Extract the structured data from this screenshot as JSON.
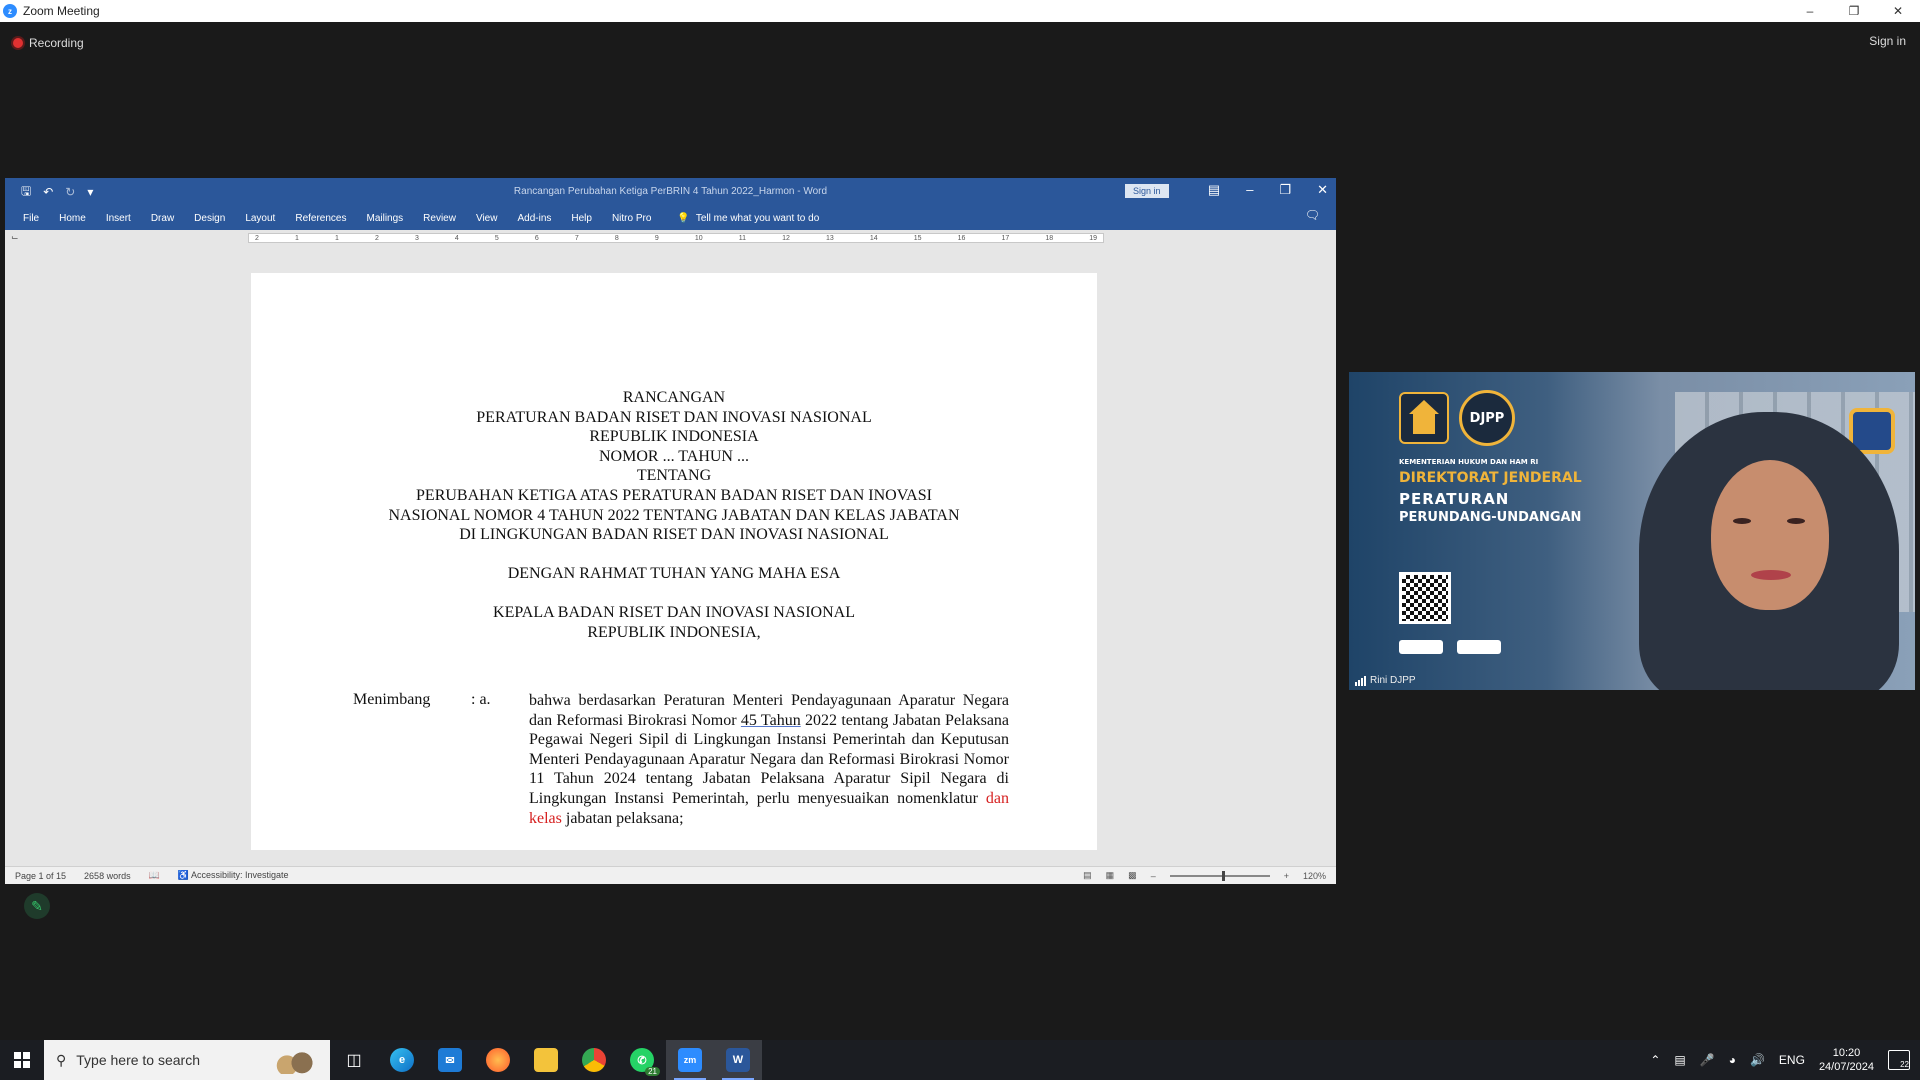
{
  "zoom": {
    "window_title": "Zoom Meeting",
    "recording_label": "Recording",
    "sign_in": "Sign in",
    "controls": {
      "minimize": "–",
      "maximize": "❐",
      "close": "✕"
    }
  },
  "word": {
    "doc_title": "Rancangan Perubahan Ketiga PerBRIN 4 Tahun 2022_Harmon  -  Word",
    "sign_in": "Sign in",
    "ribbon_tabs": [
      "File",
      "Home",
      "Insert",
      "Draw",
      "Design",
      "Layout",
      "References",
      "Mailings",
      "Review",
      "View",
      "Add-ins",
      "Help",
      "Nitro Pro"
    ],
    "tell_me": "Tell me what you want to do",
    "ruler_marks": [
      "2",
      "1",
      "1",
      "2",
      "3",
      "4",
      "5",
      "6",
      "7",
      "8",
      "9",
      "10",
      "11",
      "12",
      "13",
      "14",
      "15",
      "16",
      "17",
      "18",
      "19"
    ],
    "document": {
      "heading_lines": [
        "RANCANGAN",
        "PERATURAN BADAN RISET DAN INOVASI NASIONAL",
        "REPUBLIK INDONESIA",
        "NOMOR ... TAHUN ...",
        "TENTANG",
        "PERUBAHAN KETIGA ATAS PERATURAN BADAN RISET DAN INOVASI",
        "NASIONAL NOMOR 4 TAHUN 2022 TENTANG JABATAN DAN KELAS JABATAN",
        "DI LINGKUNGAN BADAN RISET DAN INOVASI NASIONAL"
      ],
      "blessing": "DENGAN RAHMAT TUHAN YANG MAHA ESA",
      "head_lines": [
        "KEPALA BADAN RISET DAN INOVASI NASIONAL",
        "REPUBLIK INDONESIA,"
      ],
      "menimbang_label": "Menimbang",
      "menimbang_marker": ":  a.",
      "paragraph_a_part1": "bahwa berdasarkan Peraturan Menteri Pendayagunaan Aparatur Negara dan Reformasi Birokrasi Nomor ",
      "paragraph_a_underlined": "45 Tahun",
      "paragraph_a_part2": " 2022 tentang Jabatan Pelaksana Pegawai Negeri Sipil di Lingkungan Instansi Pemerintah dan Keputusan Menteri Pendayagunaan Aparatur Negara dan Reformasi Birokrasi Nomor 11 Tahun 2024 tentang Jabatan Pelaksana Aparatur Sipil Negara di Lingkungan Instansi Pemerintah, perlu menyesuaikan nomenklatur ",
      "paragraph_a_red": "dan kelas",
      "paragraph_a_part3": " jabatan pelaksana;"
    },
    "status": {
      "page": "Page 1 of 15",
      "words": "2658 words",
      "accessibility": "Accessibility: Investigate",
      "zoom": "120%"
    }
  },
  "video": {
    "org_small": "KEMENTERIAN HUKUM DAN HAM RI",
    "org_line1": "DIREKTORAT JENDERAL",
    "org_line2": "PERATURAN",
    "org_line3": "PERUNDANG-UNDANGAN",
    "logo_text": "DJPP",
    "participant_name": "Rini DJPP",
    "colors": {
      "gold": "#f0b43a",
      "white": "#ffffff"
    }
  },
  "taskbar": {
    "search_placeholder": "Type here to search",
    "whatsapp_badge": "21",
    "language": "ENG",
    "time": "10:20",
    "date": "24/07/2024",
    "notifications": "22"
  }
}
